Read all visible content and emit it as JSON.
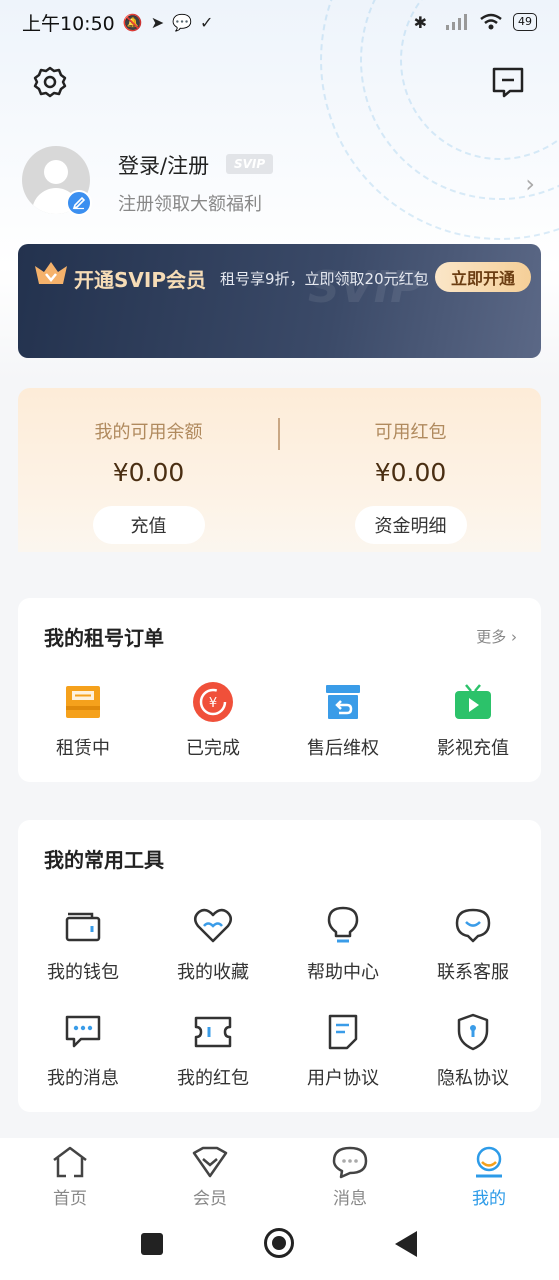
{
  "status_bar": {
    "time": "上午10:50",
    "battery": "49"
  },
  "profile": {
    "login_title": "登录/注册",
    "svip_tag": "SVIP",
    "subtitle": "注册领取大额福利"
  },
  "svip_banner": {
    "title": "开通SVIP会员",
    "description": "租号享9折，立即领取20元红包",
    "watermark": "SVIP",
    "button": "立即开通"
  },
  "balance": {
    "available_label": "我的可用余额",
    "available_value": "¥0.00",
    "recharge_button": "充值",
    "redpacket_label": "可用红包",
    "redpacket_value": "¥0.00",
    "details_button": "资金明细"
  },
  "orders": {
    "title": "我的租号订单",
    "more": "更多",
    "items": [
      {
        "label": "租赁中",
        "icon": "renting-icon"
      },
      {
        "label": "已完成",
        "icon": "completed-icon"
      },
      {
        "label": "售后维权",
        "icon": "after-sales-icon"
      },
      {
        "label": "影视充值",
        "icon": "video-recharge-icon"
      }
    ]
  },
  "tools": {
    "title": "我的常用工具",
    "items": [
      {
        "label": "我的钱包",
        "icon": "wallet-icon"
      },
      {
        "label": "我的收藏",
        "icon": "heart-icon"
      },
      {
        "label": "帮助中心",
        "icon": "lightbulb-icon"
      },
      {
        "label": "联系客服",
        "icon": "customer-service-icon"
      },
      {
        "label": "我的消息",
        "icon": "message-icon"
      },
      {
        "label": "我的红包",
        "icon": "ticket-icon"
      },
      {
        "label": "用户协议",
        "icon": "document-icon"
      },
      {
        "label": "隐私协议",
        "icon": "shield-icon"
      }
    ]
  },
  "bottom_nav": {
    "items": [
      {
        "label": "首页",
        "icon": "home-icon"
      },
      {
        "label": "会员",
        "icon": "vip-icon"
      },
      {
        "label": "消息",
        "icon": "chat-icon"
      },
      {
        "label": "我的",
        "icon": "profile-icon"
      }
    ],
    "active_index": 3
  },
  "colors": {
    "accent": "#2d9be8",
    "order_orange": "#f5a11c",
    "order_red": "#f0503a",
    "order_blue": "#3a9ce8",
    "order_green": "#2cc26a",
    "svip_gold": "#f6dcb6"
  }
}
